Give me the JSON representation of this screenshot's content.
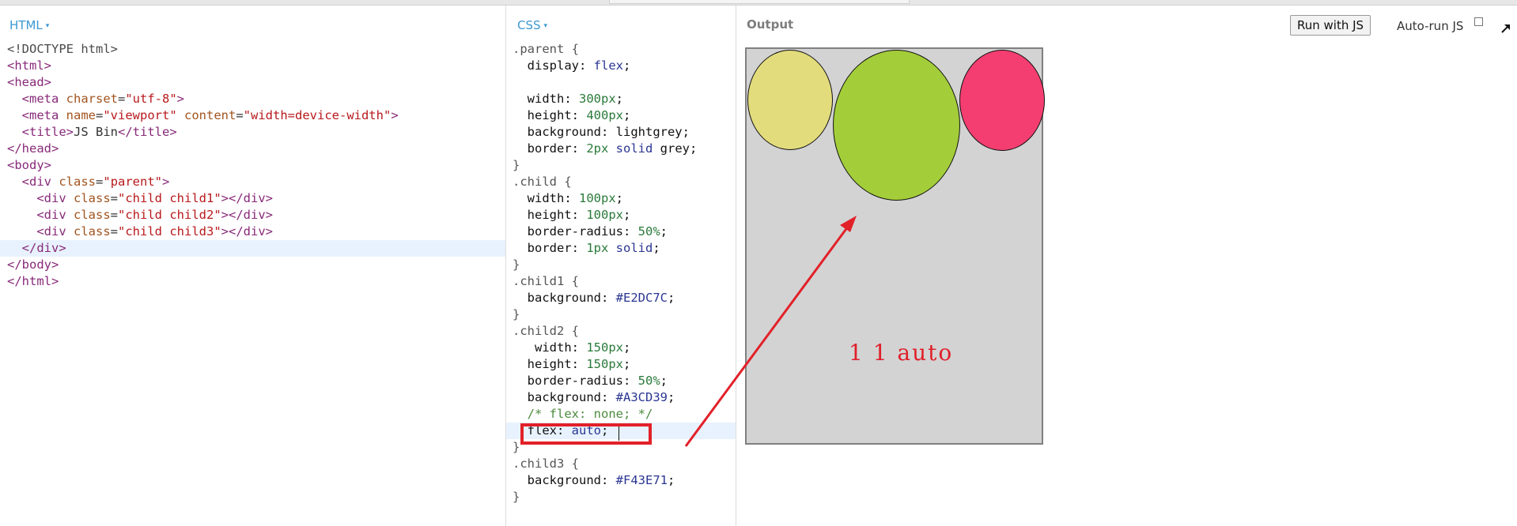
{
  "panels": {
    "html_label": "HTML",
    "css_label": "CSS",
    "output_label": "Output",
    "caret": "▾"
  },
  "toolbar": {
    "run_label": "Run with JS",
    "autorun_label": "Auto-run JS",
    "autorun_checked": false,
    "popout_icon": "popout-arrow-icon"
  },
  "html_code": [
    {
      "indent": "",
      "parts": [
        [
          "dt",
          "<!DOCTYPE html>"
        ]
      ]
    },
    {
      "indent": "",
      "parts": [
        [
          "t",
          "<html>"
        ]
      ]
    },
    {
      "indent": "",
      "parts": [
        [
          "t",
          "<head>"
        ]
      ]
    },
    {
      "indent": "  ",
      "parts": [
        [
          "t",
          "<meta "
        ],
        [
          "a",
          "charset"
        ],
        [
          "tx",
          "="
        ],
        [
          "s",
          "\"utf-8\""
        ],
        [
          "t",
          ">"
        ]
      ]
    },
    {
      "indent": "  ",
      "parts": [
        [
          "t",
          "<meta "
        ],
        [
          "a",
          "name"
        ],
        [
          "tx",
          "="
        ],
        [
          "s",
          "\"viewport\""
        ],
        [
          "a",
          " content"
        ],
        [
          "tx",
          "="
        ],
        [
          "s",
          "\"width=device-width\""
        ],
        [
          "t",
          ">"
        ]
      ]
    },
    {
      "indent": "  ",
      "parts": [
        [
          "t",
          "<title>"
        ],
        [
          "tx",
          "JS Bin"
        ],
        [
          "t",
          "</title>"
        ]
      ]
    },
    {
      "indent": "",
      "parts": [
        [
          "t",
          "</head>"
        ]
      ]
    },
    {
      "indent": "",
      "parts": [
        [
          "t",
          "<body>"
        ]
      ]
    },
    {
      "indent": "  ",
      "parts": [
        [
          "t",
          "<div "
        ],
        [
          "a",
          "class"
        ],
        [
          "tx",
          "="
        ],
        [
          "s",
          "\"parent\""
        ],
        [
          "t",
          ">"
        ]
      ]
    },
    {
      "indent": "    ",
      "parts": [
        [
          "t",
          "<div "
        ],
        [
          "a",
          "class"
        ],
        [
          "tx",
          "="
        ],
        [
          "s",
          "\"child child1\""
        ],
        [
          "t",
          "></div>"
        ]
      ]
    },
    {
      "indent": "    ",
      "parts": [
        [
          "t",
          "<div "
        ],
        [
          "a",
          "class"
        ],
        [
          "tx",
          "="
        ],
        [
          "s",
          "\"child child2\""
        ],
        [
          "t",
          "></div>"
        ]
      ]
    },
    {
      "indent": "    ",
      "parts": [
        [
          "t",
          "<div "
        ],
        [
          "a",
          "class"
        ],
        [
          "tx",
          "="
        ],
        [
          "s",
          "\"child child3\""
        ],
        [
          "t",
          "></div>"
        ]
      ]
    },
    {
      "indent": "  ",
      "parts": [
        [
          "t",
          "</div>"
        ]
      ]
    },
    {
      "indent": "",
      "parts": [
        [
          "t",
          "</body>"
        ]
      ]
    },
    {
      "indent": "",
      "parts": [
        [
          "t",
          "</html>"
        ]
      ]
    }
  ],
  "html_highlight_line": 12,
  "css_code": [
    {
      "indent": "",
      "parts": [
        [
          "sel",
          ".parent {"
        ]
      ]
    },
    {
      "indent": "  ",
      "parts": [
        [
          "prop",
          "display: "
        ],
        [
          "kw",
          "flex"
        ],
        [
          "prop",
          ";"
        ]
      ]
    },
    {
      "indent": "",
      "parts": []
    },
    {
      "indent": "  ",
      "parts": [
        [
          "prop",
          "width: "
        ],
        [
          "num",
          "300px"
        ],
        [
          "prop",
          ";"
        ]
      ]
    },
    {
      "indent": "  ",
      "parts": [
        [
          "prop",
          "height: "
        ],
        [
          "num",
          "400px"
        ],
        [
          "prop",
          ";"
        ]
      ]
    },
    {
      "indent": "  ",
      "parts": [
        [
          "prop",
          "background: "
        ],
        [
          "prop",
          "lightgrey"
        ],
        [
          "prop",
          ";"
        ]
      ]
    },
    {
      "indent": "  ",
      "parts": [
        [
          "prop",
          "border: "
        ],
        [
          "num",
          "2px "
        ],
        [
          "kw",
          "solid "
        ],
        [
          "prop",
          "grey"
        ],
        [
          "prop",
          ";"
        ]
      ]
    },
    {
      "indent": "",
      "parts": [
        [
          "sel",
          "}"
        ]
      ]
    },
    {
      "indent": "",
      "parts": [
        [
          "sel",
          ".child {"
        ]
      ]
    },
    {
      "indent": "  ",
      "parts": [
        [
          "prop",
          "width: "
        ],
        [
          "num",
          "100px"
        ],
        [
          "prop",
          ";"
        ]
      ]
    },
    {
      "indent": "  ",
      "parts": [
        [
          "prop",
          "height: "
        ],
        [
          "num",
          "100px"
        ],
        [
          "prop",
          ";"
        ]
      ]
    },
    {
      "indent": "  ",
      "parts": [
        [
          "prop",
          "border-radius: "
        ],
        [
          "num",
          "50%"
        ],
        [
          "prop",
          ";"
        ]
      ]
    },
    {
      "indent": "  ",
      "parts": [
        [
          "prop",
          "border: "
        ],
        [
          "num",
          "1px "
        ],
        [
          "kw",
          "solid"
        ],
        [
          "prop",
          ";"
        ]
      ]
    },
    {
      "indent": "",
      "parts": [
        [
          "sel",
          "}"
        ]
      ]
    },
    {
      "indent": "",
      "parts": [
        [
          "sel",
          ".child1 {"
        ]
      ]
    },
    {
      "indent": "  ",
      "parts": [
        [
          "prop",
          "background: "
        ],
        [
          "kw",
          "#E2DC7C"
        ],
        [
          "prop",
          ";"
        ]
      ]
    },
    {
      "indent": "",
      "parts": [
        [
          "sel",
          "}"
        ]
      ]
    },
    {
      "indent": "",
      "parts": [
        [
          "sel",
          ".child2 {"
        ]
      ]
    },
    {
      "indent": "   ",
      "parts": [
        [
          "prop",
          "width: "
        ],
        [
          "num",
          "150px"
        ],
        [
          "prop",
          ";"
        ]
      ]
    },
    {
      "indent": "  ",
      "parts": [
        [
          "prop",
          "height: "
        ],
        [
          "num",
          "150px"
        ],
        [
          "prop",
          ";"
        ]
      ]
    },
    {
      "indent": "  ",
      "parts": [
        [
          "prop",
          "border-radius: "
        ],
        [
          "num",
          "50%"
        ],
        [
          "prop",
          ";"
        ]
      ]
    },
    {
      "indent": "  ",
      "parts": [
        [
          "prop",
          "background: "
        ],
        [
          "kw",
          "#A3CD39"
        ],
        [
          "prop",
          ";"
        ]
      ]
    },
    {
      "indent": "  ",
      "parts": [
        [
          "cm",
          "/* flex: none; */"
        ]
      ]
    },
    {
      "indent": "  ",
      "parts": [
        [
          "prop",
          "flex: "
        ],
        [
          "kw",
          "auto"
        ],
        [
          "prop",
          ";"
        ]
      ]
    },
    {
      "indent": "",
      "parts": [
        [
          "sel",
          "}"
        ]
      ]
    },
    {
      "indent": "",
      "parts": [
        [
          "sel",
          ".child3 {"
        ]
      ]
    },
    {
      "indent": "  ",
      "parts": [
        [
          "prop",
          "background: "
        ],
        [
          "kw",
          "#F43E71"
        ],
        [
          "prop",
          ";"
        ]
      ]
    },
    {
      "indent": "",
      "parts": [
        [
          "sel",
          "}"
        ]
      ]
    }
  ],
  "css_highlight_line": 23,
  "output": {
    "children": [
      {
        "name": "child1",
        "color": "#E2DC7C"
      },
      {
        "name": "child2",
        "color": "#A3CD39"
      },
      {
        "name": "child3",
        "color": "#F43E71"
      }
    ],
    "parent_background": "#d3d3d3",
    "parent_border": "#808080"
  },
  "annotation": {
    "text": "1 1 auto",
    "color": "#e0202a"
  }
}
